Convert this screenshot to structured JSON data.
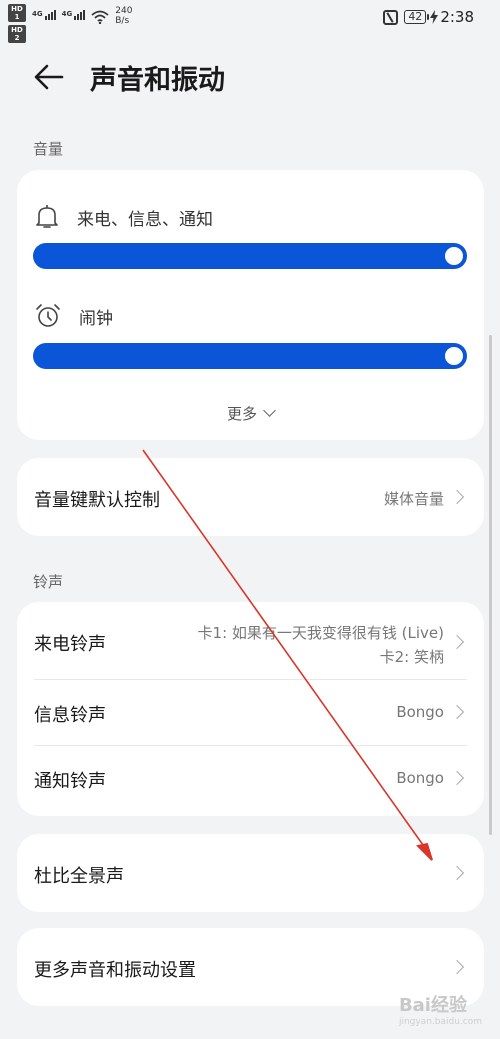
{
  "status_bar": {
    "hd1": "HD 1",
    "hd2": "HD 2",
    "net1": "4G",
    "net2": "4G",
    "speed_value": "240",
    "speed_unit": "B/s",
    "battery": "42",
    "time": "2:38"
  },
  "header": {
    "title": "声音和振动"
  },
  "volume": {
    "section_label": "音量",
    "ring_label": "来电、信息、通知",
    "ring_level": 1.0,
    "alarm_label": "闹钟",
    "alarm_level": 1.0,
    "more_label": "更多"
  },
  "volume_key": {
    "label": "音量键默认控制",
    "value": "媒体音量"
  },
  "ringtone": {
    "section_label": "铃声",
    "incoming_label": "来电铃声",
    "incoming_value_1": "卡1: 如果有一天我变得很有钱 (Live)",
    "incoming_value_2": "卡2: 笑柄",
    "message_label": "信息铃声",
    "message_value": "Bongo",
    "notify_label": "通知铃声",
    "notify_value": "Bongo"
  },
  "dolby": {
    "label": "杜比全景声"
  },
  "more_settings": {
    "label": "更多声音和振动设置"
  },
  "watermark": {
    "text": "Bai经验",
    "sub": "jingyan.baidu.com"
  },
  "colors": {
    "accent": "#0b56d8",
    "annotation": "#d9362b"
  }
}
